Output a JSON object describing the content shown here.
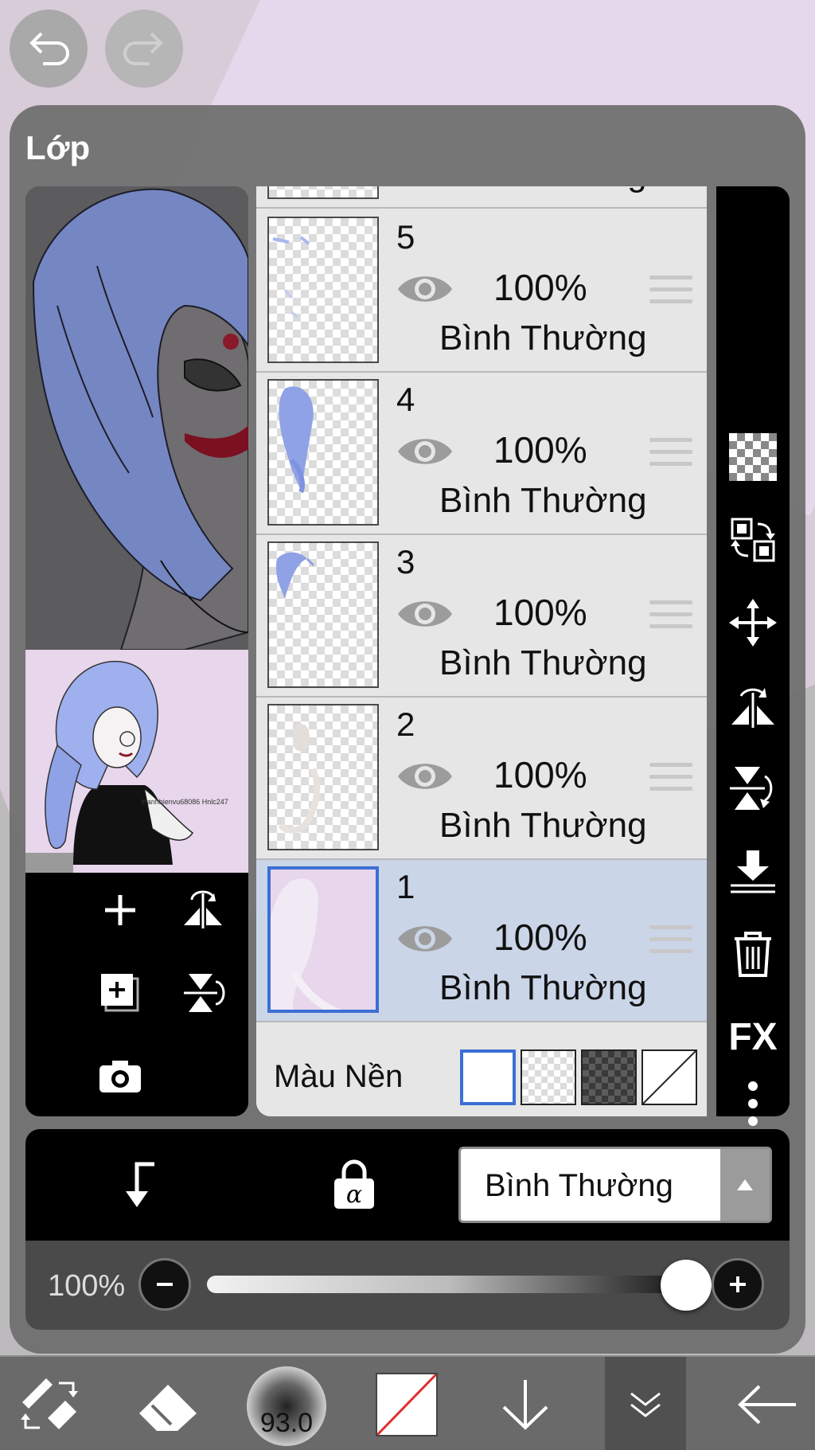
{
  "panel": {
    "title": "Lớp"
  },
  "thumbnail": {
    "signature": "thanhhienvu68086 Hnlc247"
  },
  "layers": [
    {
      "number": "5",
      "opacity": "100%",
      "mode": "Bình Thường",
      "selected": false
    },
    {
      "number": "4",
      "opacity": "100%",
      "mode": "Bình Thường",
      "selected": false
    },
    {
      "number": "3",
      "opacity": "100%",
      "mode": "Bình Thường",
      "selected": false
    },
    {
      "number": "2",
      "opacity": "100%",
      "mode": "Bình Thường",
      "selected": false
    },
    {
      "number": "1",
      "opacity": "100%",
      "mode": "Bình Thường",
      "selected": true
    }
  ],
  "partial_layer": {
    "mode": "Bình Thường"
  },
  "background": {
    "label": "Màu Nền",
    "options": [
      "white",
      "transparent",
      "dark-checker",
      "none"
    ],
    "selected": "white"
  },
  "side_tools": {
    "fx_label": "FX"
  },
  "blend": {
    "mode_value": "Bình Thường"
  },
  "opacity": {
    "label": "100%",
    "value": 1.0
  },
  "bottom_toolbar": {
    "brush_size": "93.0",
    "active": "layers-button"
  },
  "colors": {
    "selection": "#3b6fd4",
    "selected_row": "#cbd5e8",
    "panel": "#6e6e6e",
    "hair": "#8fa2e6",
    "paper": "#e7d6ec"
  }
}
